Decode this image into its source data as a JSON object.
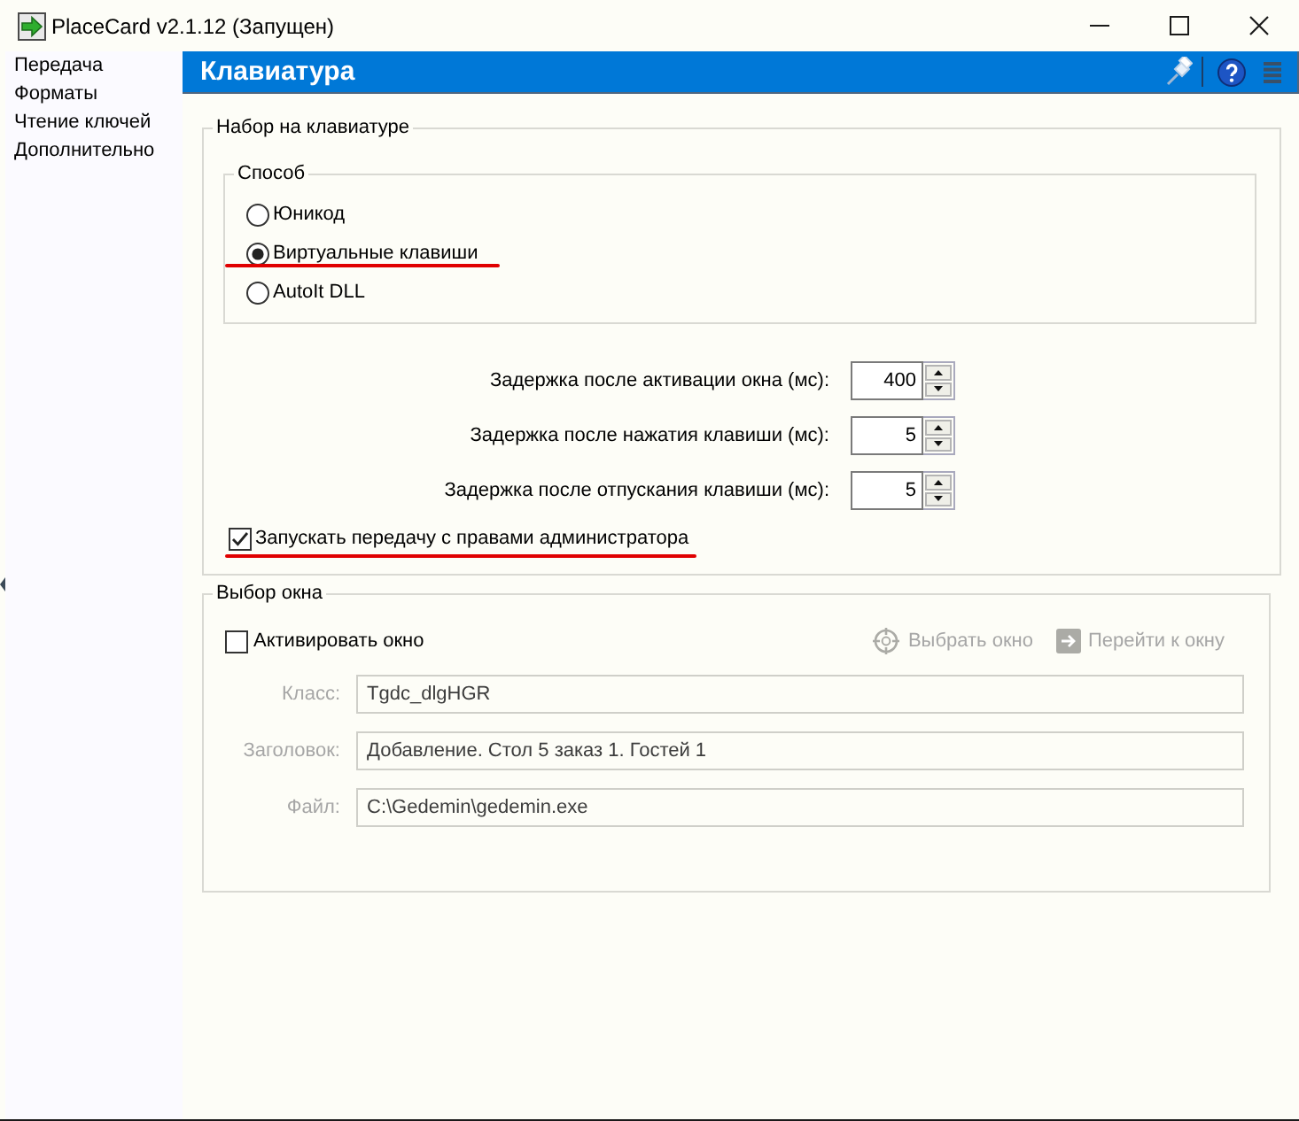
{
  "window": {
    "title": "PlaceCard v2.1.12 (Запущен)"
  },
  "sidebar": {
    "items": [
      "Передача",
      "Форматы",
      "Чтение ключей",
      "Дополнительно"
    ]
  },
  "header": {
    "title": "Клавиатура"
  },
  "keyboard_group": {
    "title": "Набор на клавиатуре",
    "method_group": {
      "title": "Способ",
      "options": [
        {
          "label": "Юникод",
          "selected": false,
          "underlined": false
        },
        {
          "label": "Виртуальные клавиши",
          "selected": true,
          "underlined": true
        },
        {
          "label": "AutoIt DLL",
          "selected": false,
          "underlined": false
        }
      ]
    },
    "delays": [
      {
        "label": "Задержка после активации окна (мс):",
        "value": "400"
      },
      {
        "label": "Задержка после нажатия клавиши (мс):",
        "value": "5"
      },
      {
        "label": "Задержка после отпускания клавиши (мс):",
        "value": "5"
      }
    ],
    "admin_checkbox": {
      "label": "Запускать передачу с правами администратора",
      "checked": true,
      "underlined": true
    }
  },
  "window_group": {
    "title": "Выбор окна",
    "activate_checkbox": {
      "label": "Активировать окно",
      "checked": false
    },
    "actions": [
      {
        "kind": "pick",
        "label": "Выбрать окно",
        "disabled": true
      },
      {
        "kind": "goto",
        "label": "Перейти к окну",
        "disabled": true
      }
    ],
    "fields": [
      {
        "label": "Класс:",
        "value": "Tgdc_dlgHGR",
        "disabled": true
      },
      {
        "label": "Заголовок:",
        "value": "Добавление. Стол 5 заказ 1. Гостей 1",
        "disabled": true
      },
      {
        "label": "Файл:",
        "value": "C:\\Gedemin\\gedemin.exe",
        "disabled": true
      }
    ]
  }
}
